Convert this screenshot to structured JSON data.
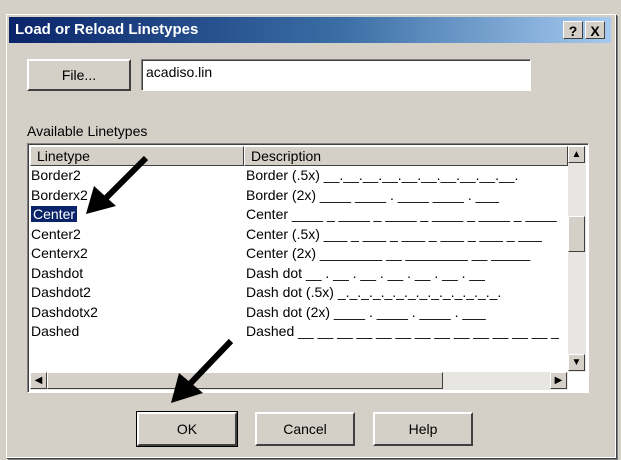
{
  "dialog": {
    "title": "Load or Reload Linetypes",
    "help_btn": "?",
    "close_btn": "X",
    "file_btn": "File...",
    "file_value": "acadiso.lin",
    "available_label": "Available Linetypes",
    "columns": [
      "Linetype",
      "Description"
    ],
    "rows": [
      {
        "name": "Border2",
        "desc": "Border (.5x) __.__.__.__.__.__.__.__.__.__."
      },
      {
        "name": "Borderx2",
        "desc": "Border (2x) ____  ____  .  ____  ____  .  ___"
      },
      {
        "name": "Center",
        "desc": "Center ____ _ ____ _ ____ _ ____ _ ____ _ ____"
      },
      {
        "name": "Center2",
        "desc": "Center (.5x) ___ _ ___ _ ___ _ ___ _ ___ _ ___"
      },
      {
        "name": "Centerx2",
        "desc": "Center (2x) ________  __  ________  __  _____"
      },
      {
        "name": "Dashdot",
        "desc": "Dash dot __ . __ . __ . __ . __ . __ . __"
      },
      {
        "name": "Dashdot2",
        "desc": "Dash dot (.5x) _._._._._._._._._._._._._._."
      },
      {
        "name": "Dashdotx2",
        "desc": "Dash dot (2x) ____  .  ____  .  ____  .  ___"
      },
      {
        "name": "Dashed",
        "desc": "Dashed __ __ __ __ __ __ __ __ __ __ __ __ __ _"
      }
    ],
    "selected_index": 2,
    "ok_btn": "OK",
    "cancel_btn": "Cancel",
    "help_button": "Help"
  }
}
